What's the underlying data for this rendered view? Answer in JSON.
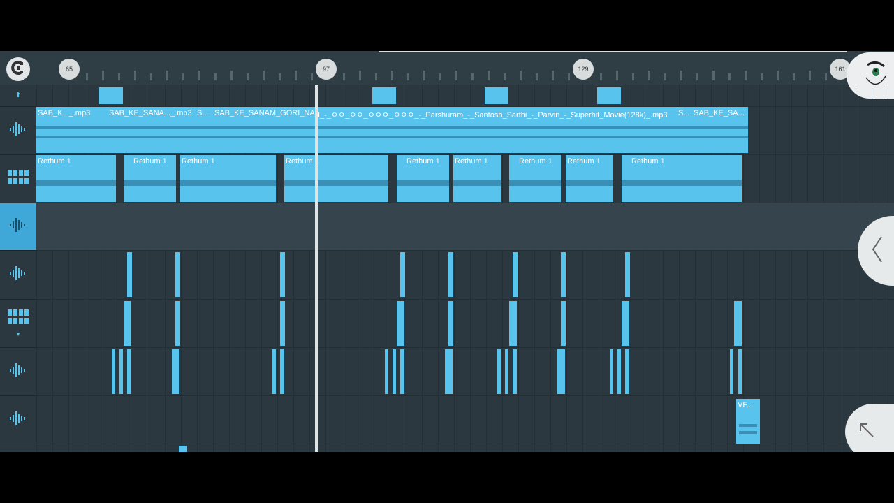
{
  "ruler": {
    "markers": [
      "65",
      "97",
      "129",
      "161"
    ]
  },
  "tracks": {
    "audio_clip_1": "SAB_K..._.mp3",
    "audio_clip_2": "SAB_KE_SANA..._.mp3",
    "audio_clip_3": "S...",
    "audio_clip_4": "SAB_KE_SANAM_GORI_NA",
    "audio_clip_5": "I_-_ㅇㅇ_ㅇㅇ_ㅇㅇㅇ_ㅇㅇㅇ_-_Parshuram_-_Santosh_Sarthi_-_Parvin_-_Superhit_Movie(128k)_.mp3",
    "audio_clip_6": "S...",
    "audio_clip_7": "SAB_KE_SA...",
    "pattern_label": "Rethum 1",
    "vf_label": "VF..."
  },
  "icons": {
    "magnet": "magnet-icon",
    "menu": "fl-logo-icon",
    "back": "chevron-left-icon",
    "expand": "arrow-up-left-icon"
  },
  "colors": {
    "background": "#2b3840",
    "clip": "#58c3ec",
    "accent": "#3fa8d8"
  }
}
